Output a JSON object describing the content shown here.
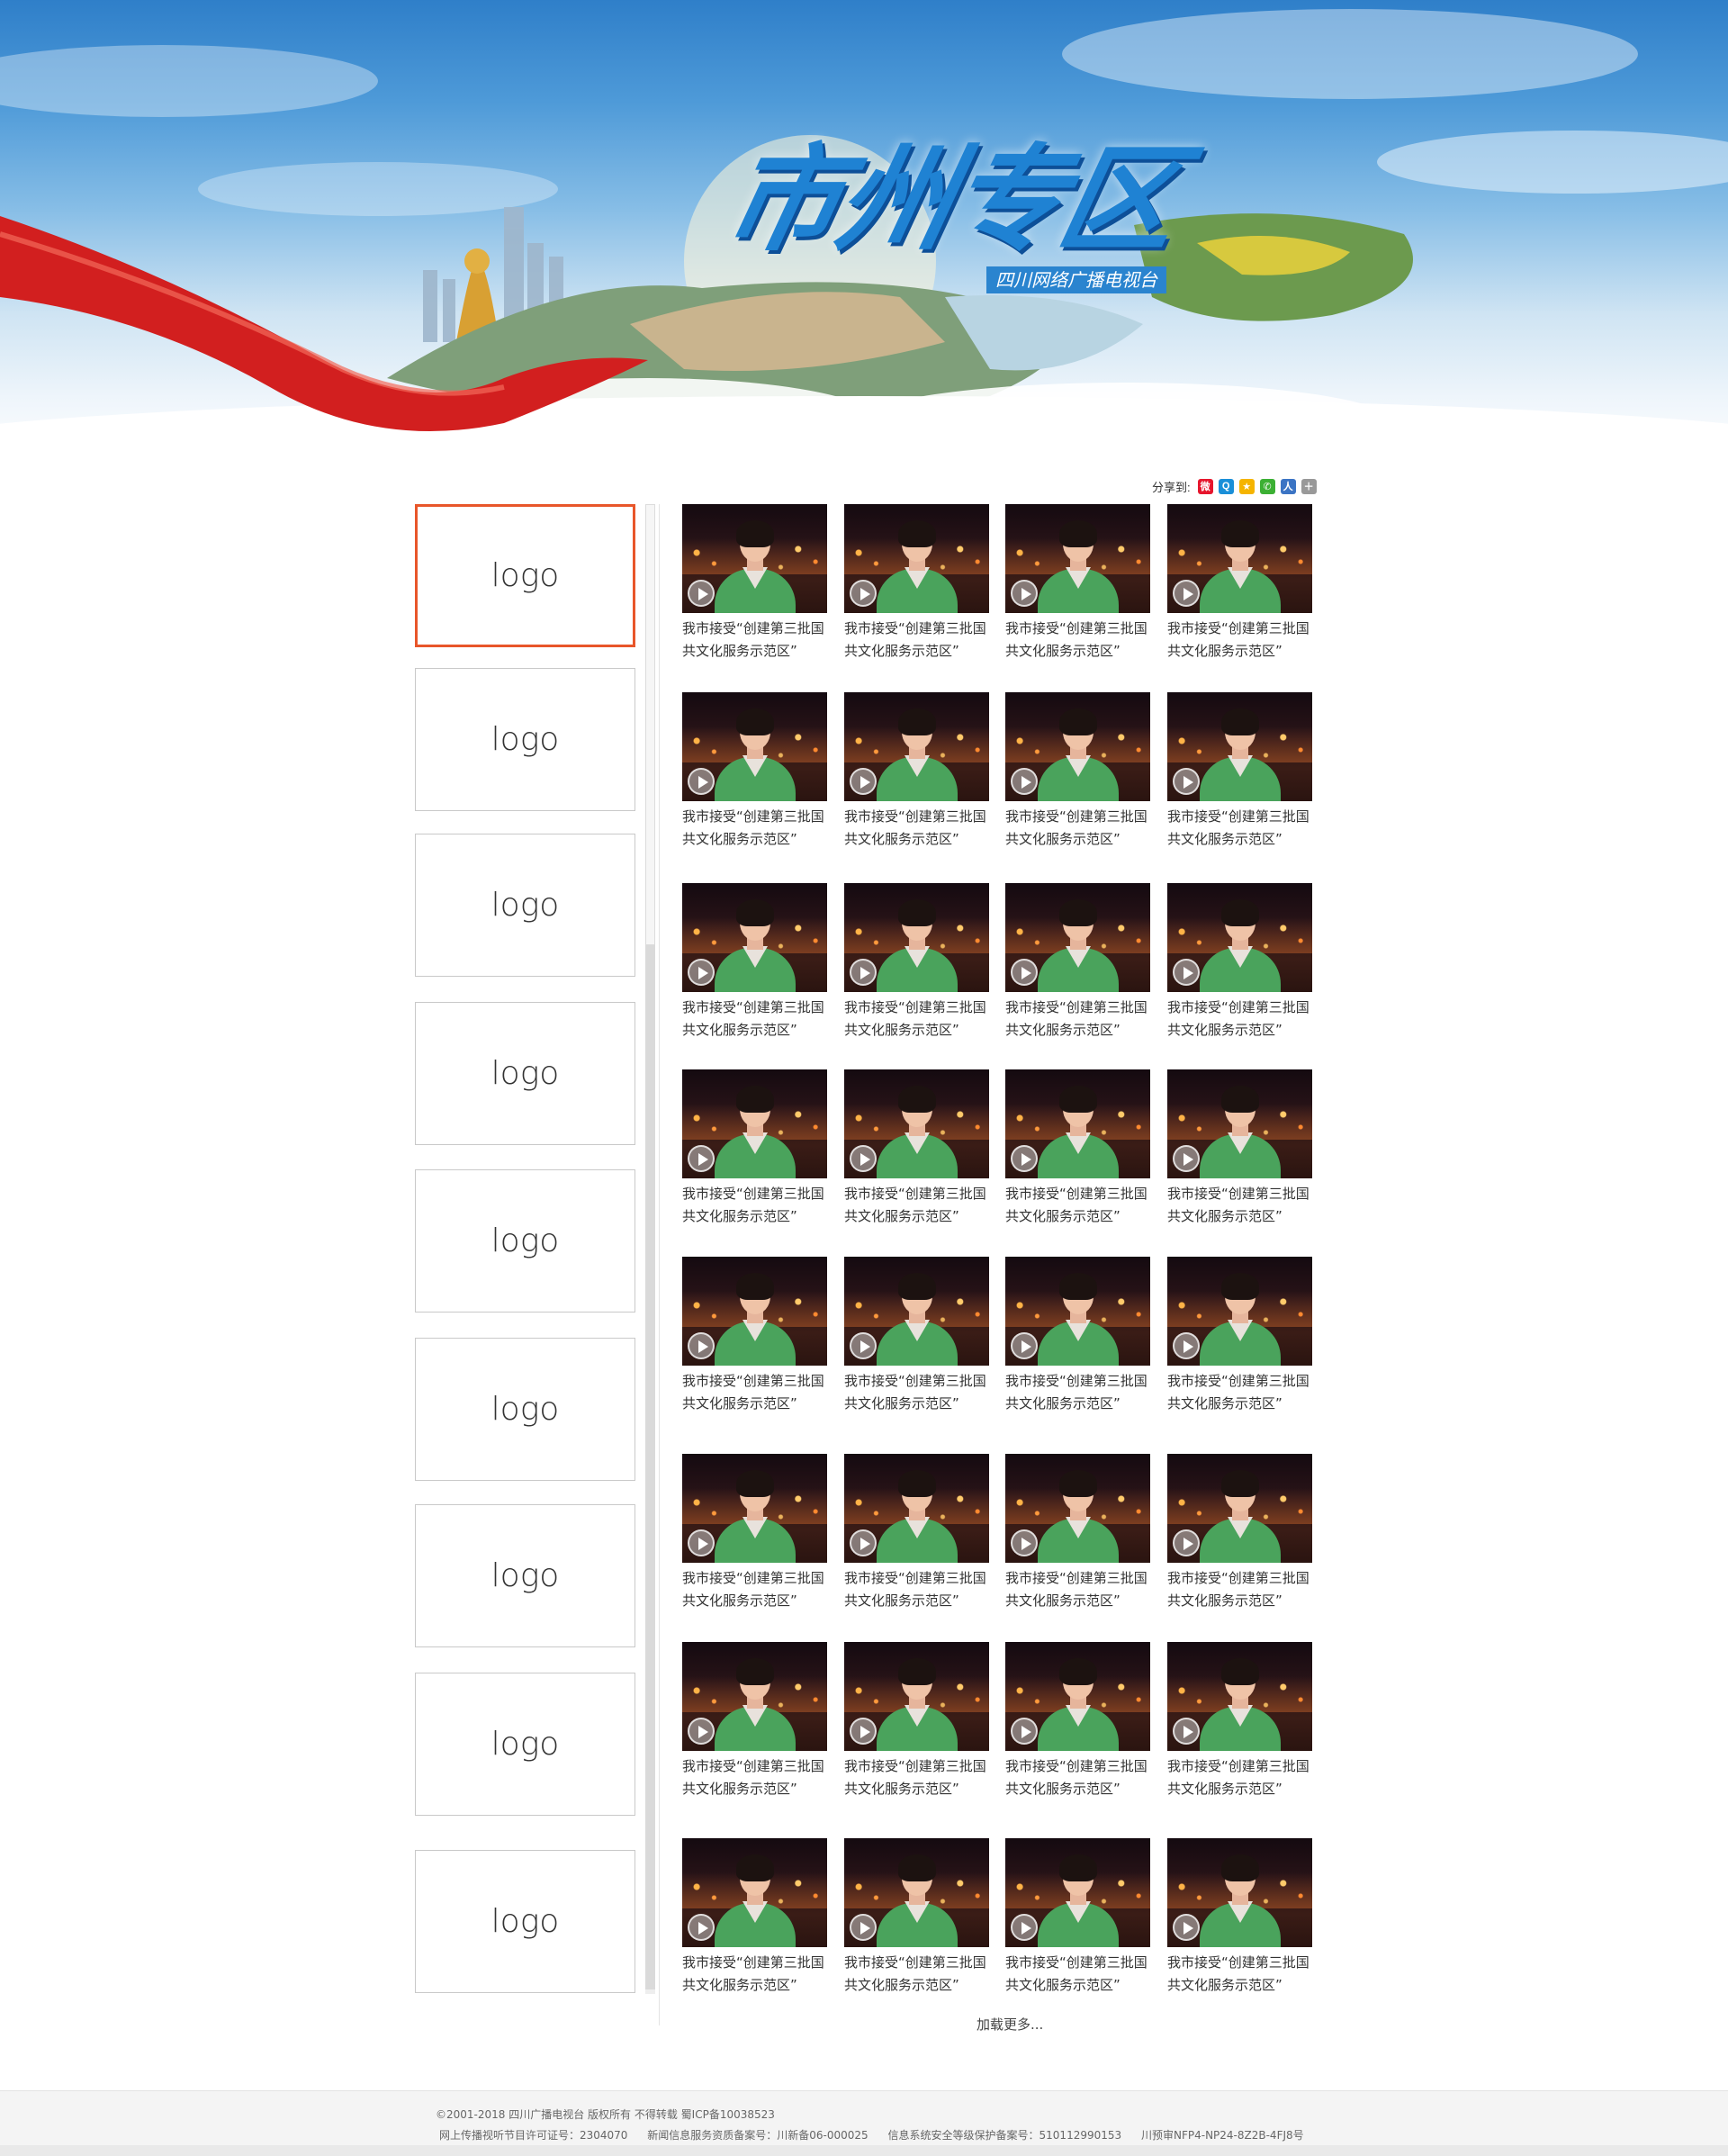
{
  "banner": {
    "title": "市州专区",
    "subtitle": "四川网络广播电视台"
  },
  "share": {
    "label": "分享到:",
    "icons": [
      {
        "name": "weibo-icon",
        "color": "#e6162d",
        "glyph": "微"
      },
      {
        "name": "qq-icon",
        "color": "#1a8fd8",
        "glyph": "Q"
      },
      {
        "name": "qzone-icon",
        "color": "#f5b400",
        "glyph": "★"
      },
      {
        "name": "wechat-icon",
        "color": "#3cb034",
        "glyph": "✆"
      },
      {
        "name": "renren-icon",
        "color": "#3b74c4",
        "glyph": "人"
      },
      {
        "name": "more-share-icon",
        "color": "#999999",
        "glyph": "＋"
      }
    ]
  },
  "logos": [
    "logo",
    "logo",
    "logo",
    "logo",
    "logo",
    "logo",
    "logo",
    "logo",
    "logo"
  ],
  "video_caption": {
    "line1": "我市接受“创建第三批国",
    "line2": "共文化服务示范区”"
  },
  "videos": 32,
  "load_more": "加载更多...",
  "footer": {
    "copyright": "©2001-2018 四川广播电视台 版权所有 不得转载   蜀ICP备10038523",
    "license1": "网上传播视听节目许可证号：2304070",
    "license2": "新闻信息服务资质备案号：川新备06-000025",
    "license3": "信息系统安全等级保护备案号：510112990153",
    "license4": "川预审NFP4-NP24-8Z2B-4FJ8号"
  }
}
